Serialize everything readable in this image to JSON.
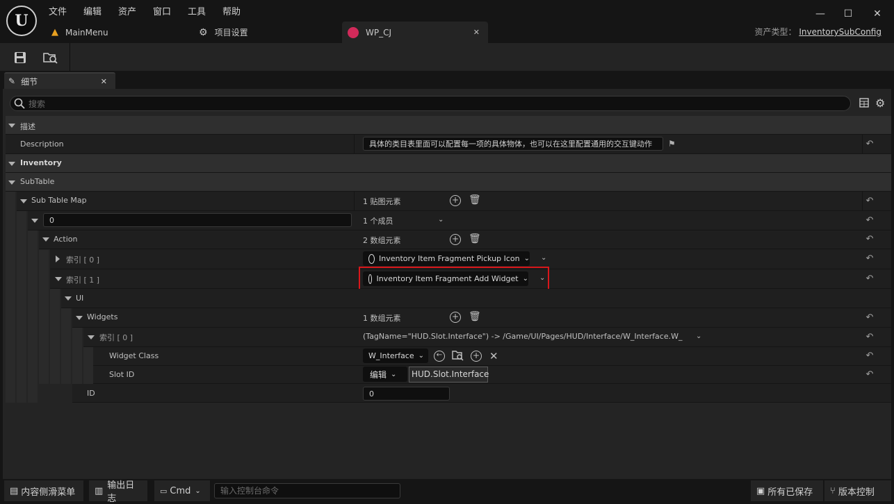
{
  "app": {
    "menu": [
      "文件",
      "编辑",
      "资产",
      "窗口",
      "工具",
      "帮助"
    ],
    "tabs": [
      {
        "label": "MainMenu"
      },
      {
        "label": "项目设置"
      },
      {
        "label": "WP_CJ"
      }
    ],
    "asset_type_label": "资产类型：",
    "asset_type_value": "InventorySubConfig"
  },
  "details": {
    "tab_label": "细节",
    "search_placeholder": "搜索"
  },
  "rows": {
    "cat_desc": "描述",
    "description_label": "Description",
    "description_value": "具体的类目表里面可以配置每一项的具体物体，也可以在这里配置通用的交互键动作",
    "cat_inventory": "Inventory",
    "cat_subtable": "SubTable",
    "subtablemap_label": "Sub Table Map",
    "subtablemap_value": "1 贴图元素",
    "key_value": "0",
    "members_value": "1 个成员",
    "action_label": "Action",
    "action_value": "2 数组元素",
    "index0_label": "索引 [ 0 ]",
    "index0_value": "Inventory Item Fragment Pickup Icon",
    "index1_label": "索引 [ 1 ]",
    "index1_value": "Inventory Item Fragment Add Widget",
    "ui_label": "UI",
    "widgets_label": "Widgets",
    "widgets_value": "1 数组元素",
    "widgets_index0_label": "索引 [ 0 ]",
    "widgets_index0_value": "(TagName=\"HUD.Slot.Interface\") -> /Game/UI/Pages/HUD/Interface/W_Interface.W_Interfac",
    "widget_class_label": "Widget Class",
    "widget_class_value": "W_Interface",
    "slot_id_label": "Slot ID",
    "slot_id_edit": "编辑",
    "slot_id_value": "HUD.Slot.Interface",
    "id_label": "ID",
    "id_value": "0"
  },
  "bottom": {
    "content_drawer": "内容侧滑菜单",
    "output_log": "输出日志",
    "cmd": "Cmd",
    "console_placeholder": "输入控制台命令",
    "all_saved": "所有已保存",
    "source_control": "版本控制"
  },
  "colors": {
    "highlight": "#d9161a",
    "background": "#151515",
    "panel": "#242424"
  }
}
